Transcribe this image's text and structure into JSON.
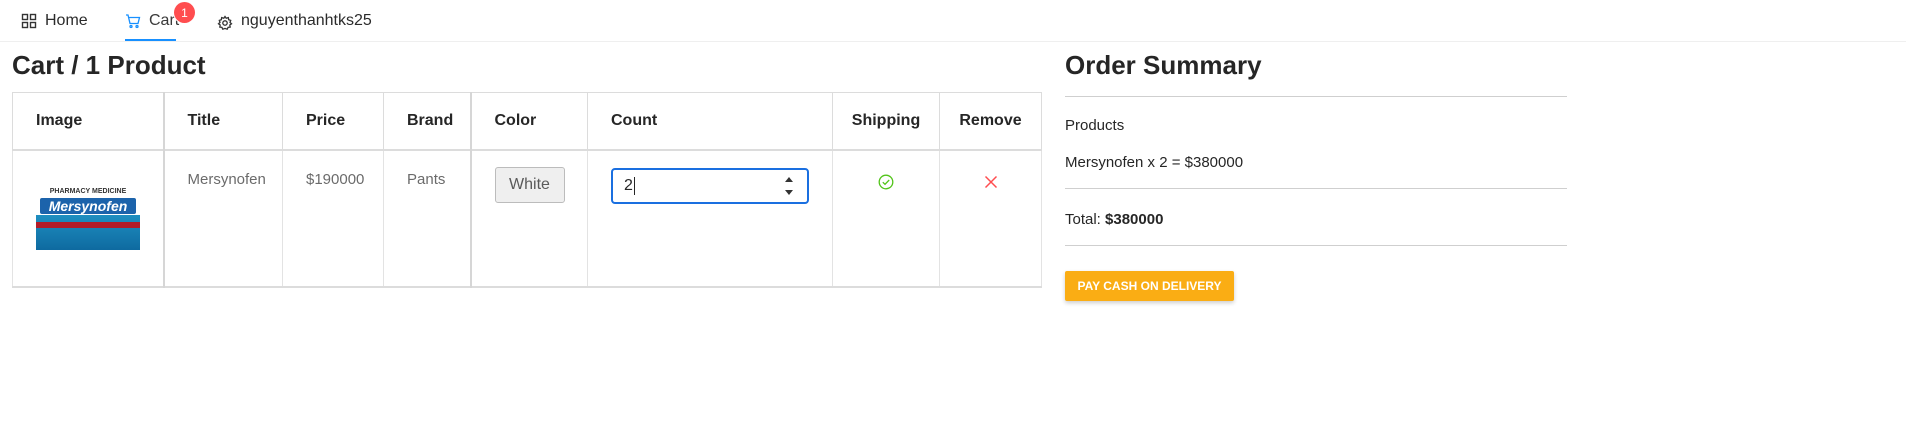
{
  "nav": {
    "home_label": "Home",
    "cart_label": "Cart",
    "cart_badge": "1",
    "user_label": "nguyenthanhtks25"
  },
  "cart": {
    "title": "Cart / 1 Product",
    "columns": [
      "Image",
      "Title",
      "Price",
      "Brand",
      "Color",
      "Count",
      "Shipping",
      "Remove"
    ],
    "rows": [
      {
        "title": "Mersynofen",
        "price": "$190000",
        "brand": "Pants",
        "color": "White",
        "count": "2",
        "image_top_text": "PHARMACY MEDICINE",
        "image_brand_text": "Mersynofen"
      }
    ]
  },
  "summary": {
    "title": "Order Summary",
    "products_label": "Products",
    "line_item": "Mersynofen x 2 = $380000",
    "total_label": "Total:",
    "total_value": "$380000",
    "pay_button": "PAY CASH ON DELIVERY"
  },
  "colors": {
    "accent": "#1890ff",
    "badge": "#ff4d4f",
    "pay_button": "#faad14",
    "shipping_ok": "#52c41a",
    "remove": "#ff4d4f"
  },
  "icons": {
    "home": "appstore-icon",
    "cart": "shopping-cart-icon",
    "user": "gear-icon",
    "shipping": "check-circle-icon",
    "remove": "close-icon"
  }
}
